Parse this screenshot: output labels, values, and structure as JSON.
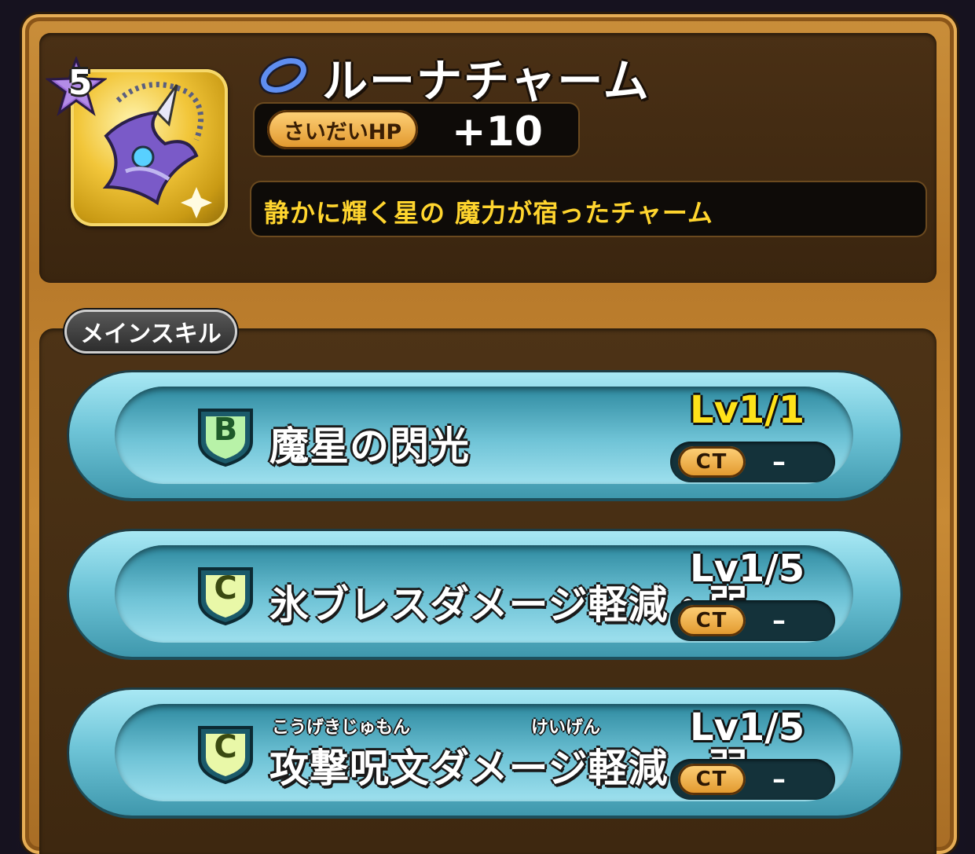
{
  "item": {
    "rarity": "5",
    "name": "ルーナチャーム",
    "stat_label": "さいだいHP",
    "stat_value": "+10",
    "description": "静かに輝く星の 魔力が宿ったチャーム",
    "icon": "moon-charm-icon",
    "type_icon": "accessory-ring-icon"
  },
  "skills_section": {
    "label": "メインスキル",
    "skills": [
      {
        "rank": "B",
        "name": "魔星の閃光",
        "level": "Lv1/1",
        "level_max": true,
        "ct_label": "CT",
        "ct_value": "–"
      },
      {
        "rank": "C",
        "name": "氷ブレスダメージ軽減・弱",
        "level": "Lv1/5",
        "level_max": false,
        "ct_label": "CT",
        "ct_value": "–"
      },
      {
        "rank": "C",
        "name": "攻撃呪文ダメージ軽減・弱",
        "ruby_1": "こうげきじゅもん",
        "ruby_2": "けいげん",
        "level": "Lv1/5",
        "level_max": false,
        "ct_label": "CT",
        "ct_value": "–"
      }
    ]
  },
  "colors": {
    "frame_gold": "#c98e3a",
    "panel_brown": "#3a250f",
    "description_yellow": "#ffd52e",
    "skill_cyan": "#6fc5d8",
    "level_max_yellow": "#ffe21a"
  }
}
